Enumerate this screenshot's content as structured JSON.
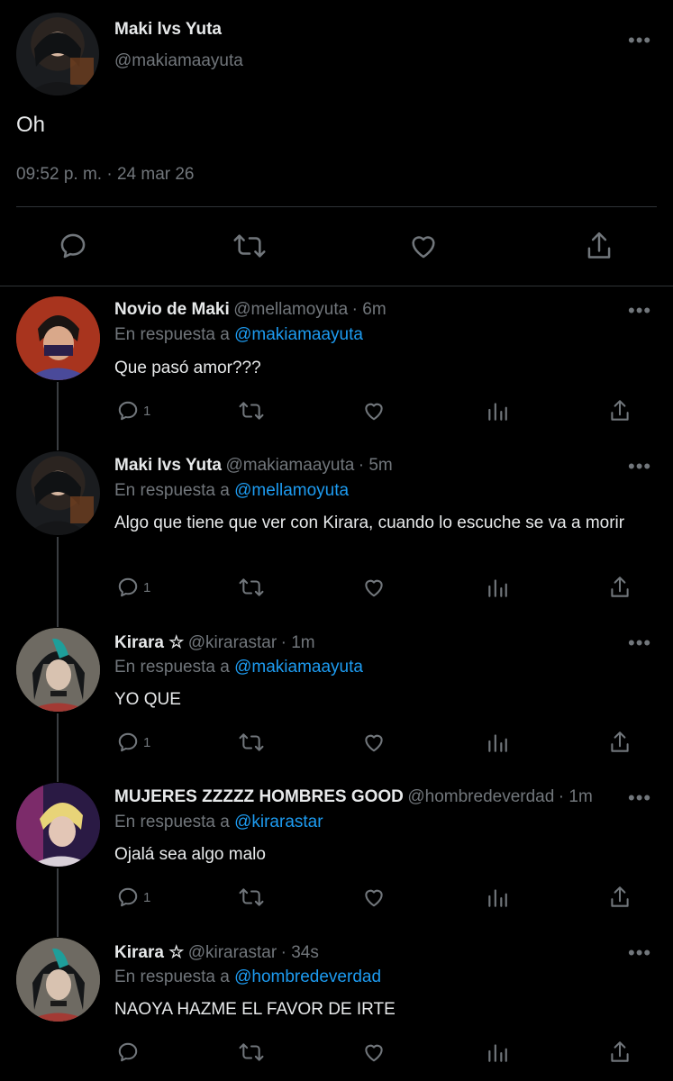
{
  "main_tweet": {
    "name": "Maki lvs Yuta",
    "handle": "@makiamaayuta",
    "text": "Oh",
    "time": "09:52 p. m.",
    "sep": "·",
    "date": "24 mar 26"
  },
  "replies": [
    {
      "name": "Novio de Maki",
      "handle": "@mellamoyuta",
      "age": "· 6m",
      "reply_prefix": "En respuesta a",
      "reply_to": "@makiamaayuta",
      "text": "Que pasó amor???",
      "reply_count": "1"
    },
    {
      "name": "Maki lvs Yuta",
      "handle": "@makiamaayuta",
      "age": "· 5m",
      "reply_prefix": "En respuesta a",
      "reply_to": "@mellamoyuta",
      "text": "Algo que tiene que ver con Kirara, cuando lo escuche se va a morir",
      "reply_count": "1"
    },
    {
      "name": "Kirara ☆",
      "handle": "@kirarastar",
      "age": "· 1m",
      "reply_prefix": "En respuesta a",
      "reply_to": "@makiamaayuta",
      "text": "YO QUE",
      "reply_count": "1"
    },
    {
      "name": "MUJERES ZZZZZ HOMBRES GOOD",
      "handle": "@hombredeverdad",
      "age": "· 1m",
      "reply_prefix": "En respuesta a",
      "reply_to": "@kirarastar",
      "text": "Ojalá sea algo malo",
      "reply_count": "1"
    },
    {
      "name": "Kirara ☆",
      "handle": "@kirarastar",
      "age": "· 34s",
      "reply_prefix": "En respuesta a",
      "reply_to": "@hombredeverdad",
      "text": "NAOYA HAZME EL FAVOR DE IRTE",
      "reply_count": ""
    }
  ],
  "more_label": "•••",
  "icons": {
    "reply": "reply-icon",
    "retweet": "retweet-icon",
    "like": "like-icon",
    "views": "views-icon",
    "share": "share-icon"
  },
  "colors": {
    "background": "#000000",
    "text": "#e7e9ea",
    "muted": "#71767b",
    "link": "#1d9bf0"
  }
}
